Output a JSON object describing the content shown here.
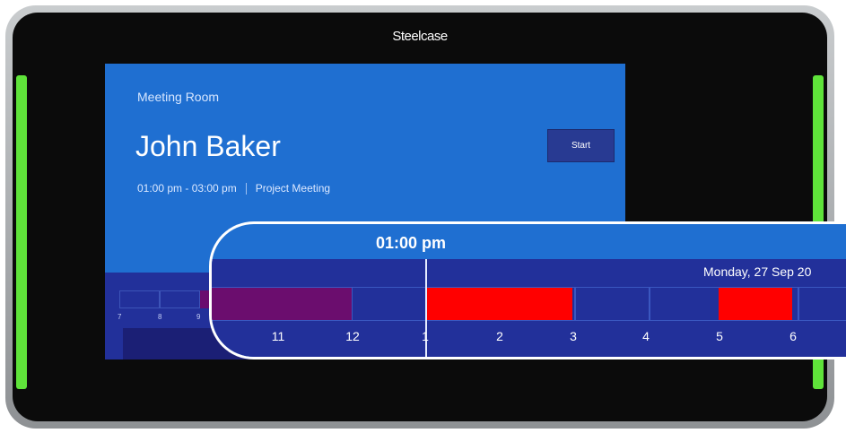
{
  "device": {
    "brand": "Steelcase"
  },
  "screen": {
    "room_label": "Meeting Room",
    "organizer": "John Baker",
    "time_range": "01:00 pm - 03:00 pm",
    "meeting_title": "Project Meeting",
    "start_button": "Start"
  },
  "mini_timeline": {
    "hour_labels": [
      "7",
      "8",
      "9"
    ]
  },
  "zoom": {
    "current_time": "01:00 pm",
    "date": "Monday, 27 Sep 20",
    "hour_labels": [
      "11",
      "12",
      "1",
      "2",
      "3",
      "4",
      "5",
      "6"
    ]
  },
  "colors": {
    "screen_bg": "#1f6fd1",
    "timeline_bg": "#22309a",
    "booking_past": "#6b0d6e",
    "booking_upcoming": "#ff0000",
    "led_accent": "#5fe33a"
  }
}
